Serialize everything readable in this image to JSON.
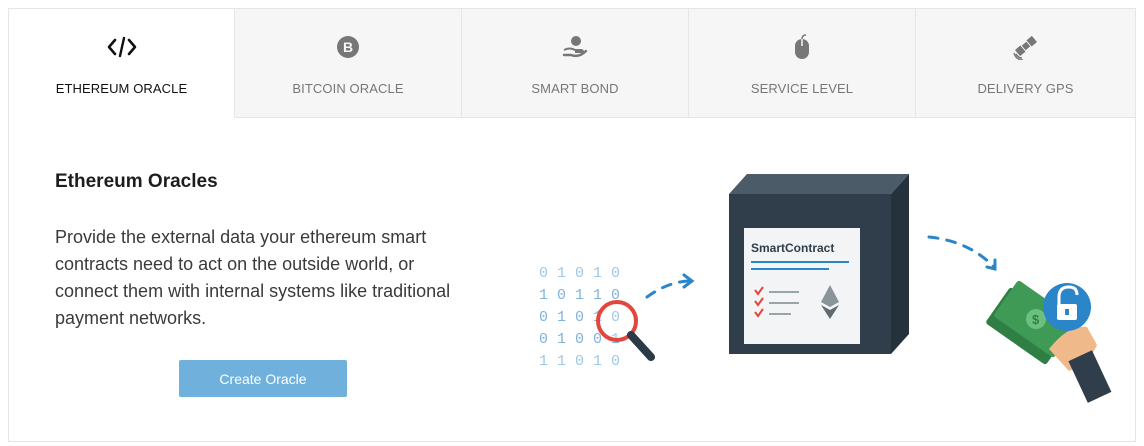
{
  "tabs": [
    {
      "label": "ETHEREUM ORACLE",
      "icon": "code-icon",
      "active": true
    },
    {
      "label": "BITCOIN ORACLE",
      "icon": "bitcoin-icon",
      "active": false
    },
    {
      "label": "SMART BOND",
      "icon": "hand-coin-icon",
      "active": false
    },
    {
      "label": "SERVICE LEVEL",
      "icon": "mouse-icon",
      "active": false
    },
    {
      "label": "DELIVERY GPS",
      "icon": "satellite-icon",
      "active": false
    }
  ],
  "panel": {
    "title": "Ethereum Oracles",
    "description": "Provide the external data your ethereum smart contracts need to act on the outside world, or connect them with internal systems like traditional payment networks.",
    "cta_label": "Create Oracle"
  },
  "illustration": {
    "contract_label": "SmartContract",
    "binary_rows": [
      "0 1 0 1 0",
      "1 0 1 1 0",
      "0 1 0 1 0",
      "0 1 0 0 1",
      "1 1 0 1 0"
    ]
  },
  "colors": {
    "accent": "#6fb0dd",
    "box_dark": "#2f3e4a",
    "money_green": "#3f9a55",
    "lock_blue": "#2a86c9",
    "magnifier_red": "#e2463c"
  }
}
